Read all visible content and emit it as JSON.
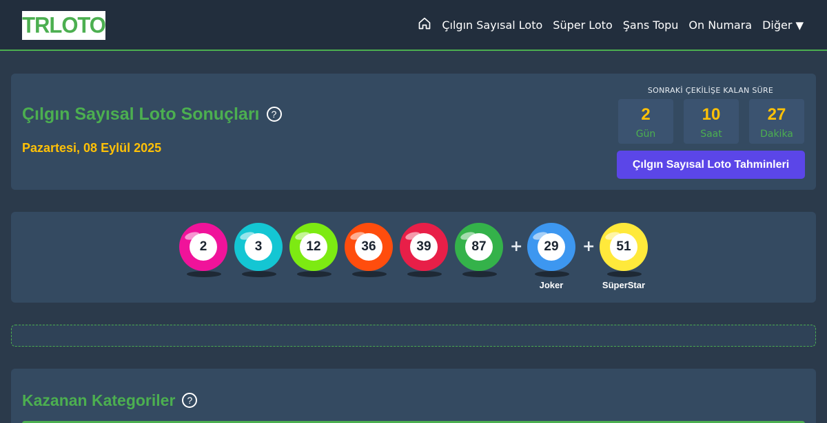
{
  "header": {
    "logo": "TRLOTO",
    "nav": [
      {
        "label": "Çılgın Sayısal Loto"
      },
      {
        "label": "Süper Loto"
      },
      {
        "label": "Şans Topu"
      },
      {
        "label": "On Numara"
      },
      {
        "label": "Diğer"
      }
    ],
    "home_icon": "home-icon",
    "dropdown_icon": "caret-down-icon"
  },
  "result": {
    "title": "Çılgın Sayısal Loto Sonuçları",
    "help_symbol": "?",
    "date": "Pazartesi, 08 Eylül 2025"
  },
  "countdown": {
    "label": "SONRAKİ ÇEKİLİŞE KALAN SÜRE",
    "days": {
      "value": "2",
      "unit": "Gün"
    },
    "hours": {
      "value": "10",
      "unit": "Saat"
    },
    "minutes": {
      "value": "27",
      "unit": "Dakika"
    },
    "cta_label": "Çılgın Sayısal Loto Tahminleri"
  },
  "draw": {
    "numbers": [
      "2",
      "3",
      "12",
      "36",
      "39",
      "87"
    ],
    "number_colors": [
      "#f0139a",
      "#14c6d3",
      "#7dea12",
      "#ff4d0d",
      "#e81f48",
      "#34b24a"
    ],
    "plus": "+",
    "joker": {
      "value": "29",
      "label": "Joker",
      "color": "#3d97f0"
    },
    "superstar": {
      "value": "51",
      "label": "SüperStar",
      "color": "#ffe93b"
    }
  },
  "winners": {
    "title": "Kazanan Kategoriler",
    "help_symbol": "?"
  }
}
